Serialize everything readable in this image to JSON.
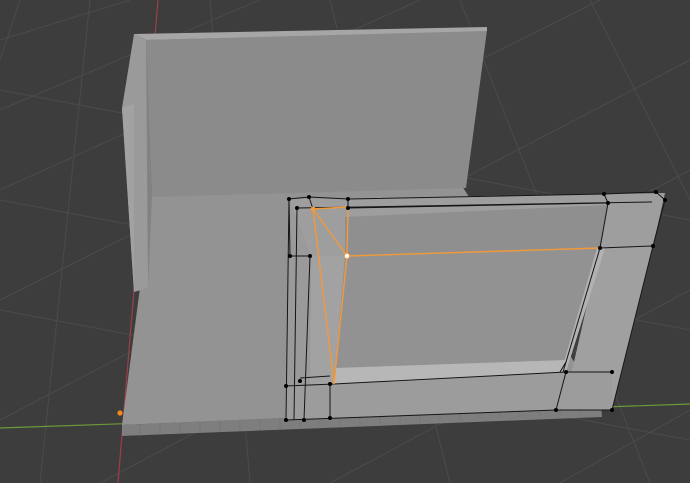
{
  "viewport": {
    "mode": "edit-mode",
    "background_color": "#3d3d3d",
    "grid_color": "#4a4a4a",
    "x_axis_color": "#6b9a3c",
    "y_axis_color": "#9c3e4c",
    "origin_marker_color": "#f08a1e"
  },
  "scene": {
    "objects": [
      {
        "name": "floor-slab",
        "color": "#929292"
      },
      {
        "name": "back-wall",
        "color": "#8c8c8c"
      },
      {
        "name": "left-wall",
        "color": "#9a9a9a"
      },
      {
        "name": "window-frame",
        "color": "#9d9d9d"
      }
    ],
    "mesh": {
      "edge_color": "#111111",
      "vertex_color": "#000000",
      "selected_edge_color": "#f29a3a",
      "active_vertex_color": "#ffffff"
    }
  }
}
